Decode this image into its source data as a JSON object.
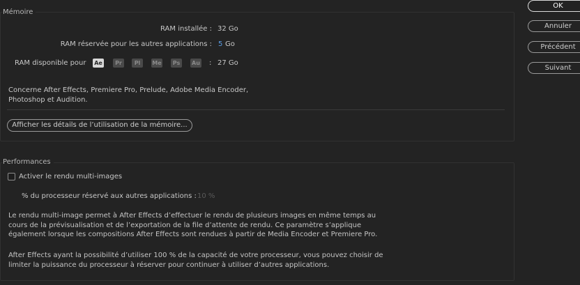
{
  "memory": {
    "title": "Mémoire",
    "installed_label": "RAM installée :",
    "installed_value": "32 Go",
    "reserved_label": "RAM réservée pour les autres applications :",
    "reserved_value": "5",
    "reserved_unit": "Go",
    "available_label": "RAM disponible pour",
    "available_colon": ":",
    "available_value": "27 Go",
    "apps": [
      "Ae",
      "Pr",
      "Pl",
      "Me",
      "Ps",
      "Au"
    ],
    "note_line1": "Concerne After Effects, Premiere Pro, Prelude, Adobe Media Encoder,",
    "note_line2": "Photoshop et Audition.",
    "details_button": "Afficher les détails de l’utilisation de la mémoire..."
  },
  "performance": {
    "title": "Performances",
    "multiframe_label": "Activer le rendu multi-images",
    "multiframe_checked": false,
    "cpu_label": "% du processeur réservé aux autres applications :",
    "cpu_value": "10 %",
    "para1_line1": "Le rendu multi-image permet à After Effects d’effectuer le rendu de plusieurs images en même temps au",
    "para1_line2": "cours de la prévisualisation et de l’exportation de la file d’attente de rendu. Ce paramètre s’applique",
    "para1_line3": "également lorsque les compositions After Effects sont rendues à partir de Media Encoder et Premiere Pro.",
    "para2_line1": "After Effects ayant la possibilité d’utiliser 100 % de la capacité de votre processeur, vous pouvez choisir de",
    "para2_line2": "limiter la puissance du processeur à réserver pour continuer à utiliser d’autres applications."
  },
  "dialog_buttons": {
    "ok": "OK",
    "cancel": "Annuler",
    "previous": "Précédent",
    "next": "Suivant"
  },
  "colors": {
    "background": "#232323",
    "accent_value": "#5b9ee6",
    "active_badge": "#d8d8d8"
  }
}
